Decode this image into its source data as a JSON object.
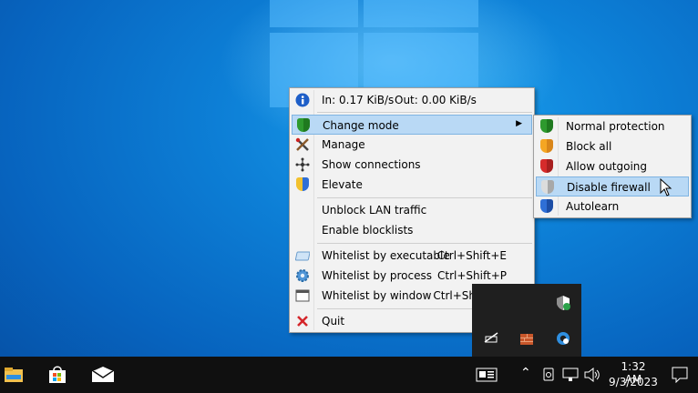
{
  "menu": {
    "traffic": {
      "in": "In: 0.17 KiB/s",
      "out": "Out: 0.00 KiB/s"
    },
    "items": [
      {
        "label": "Change mode",
        "icon": "green-shield-icon"
      },
      {
        "label": "Manage",
        "icon": "tools-icon"
      },
      {
        "label": "Show connections",
        "icon": "connections-icon"
      },
      {
        "label": "Elevate",
        "icon": "uac-shield-icon"
      },
      {
        "label": "Unblock LAN traffic"
      },
      {
        "label": "Enable blocklists"
      },
      {
        "label": "Whitelist by executable",
        "shortcut": "Ctrl+Shift+E",
        "icon": "executable-icon"
      },
      {
        "label": "Whitelist by process",
        "shortcut": "Ctrl+Shift+P",
        "icon": "gear-icon"
      },
      {
        "label": "Whitelist by window",
        "shortcut": "Ctrl+Shift+W",
        "icon": "window-icon"
      },
      {
        "label": "Quit",
        "icon": "close-icon"
      }
    ]
  },
  "submenu": {
    "items": [
      {
        "label": "Normal protection",
        "icon": "green-shield-icon"
      },
      {
        "label": "Block all",
        "icon": "orange-shield-icon"
      },
      {
        "label": "Allow outgoing",
        "icon": "red-shield-icon"
      },
      {
        "label": "Disable firewall",
        "icon": "gray-shield-icon"
      },
      {
        "label": "Autolearn",
        "icon": "blue-shield-icon"
      }
    ]
  },
  "taskbar": {
    "time": "1:32 AM",
    "date": "9/3/2023",
    "pinned": [
      "file-explorer-icon",
      "store-icon",
      "mail-icon"
    ]
  },
  "colors": {
    "highlight": "#b9d9f5",
    "desktop": "#0d7fd6",
    "taskbar": "#101010"
  }
}
